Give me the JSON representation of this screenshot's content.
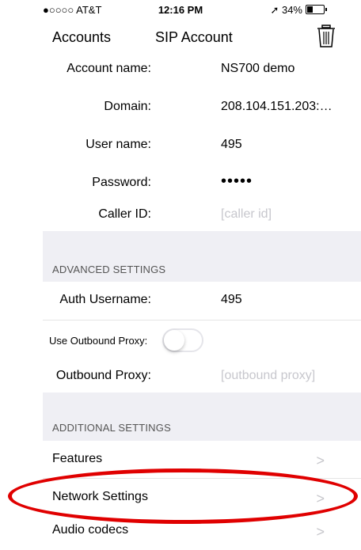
{
  "status_bar": {
    "carrier": "●○○○○ AT&T",
    "time": "12:16 PM",
    "battery": "34%",
    "icons": [
      "signal-dots-icon",
      "wifi-icon",
      "location-arrow-icon",
      "battery-icon"
    ]
  },
  "nav": {
    "back_label": "Accounts",
    "title": "SIP Account",
    "delete_icon": "trash-icon"
  },
  "account": {
    "rows": [
      {
        "label": "Account name:",
        "value": "NS700 demo",
        "placeholder": false
      },
      {
        "label": "Domain:",
        "value": "208.104.151.203:…",
        "placeholder": false
      },
      {
        "label": "User name:",
        "value": "495",
        "placeholder": false
      },
      {
        "label": "Password:",
        "value": "•••••",
        "placeholder": false
      },
      {
        "label": "Caller ID:",
        "value": "[caller id]",
        "placeholder": true
      }
    ]
  },
  "advanced": {
    "header": "ADVANCED SETTINGS",
    "auth_username_label": "Auth Username:",
    "auth_username_value": "495",
    "use_outbound_proxy_label": "Use Outbound Proxy:",
    "use_outbound_proxy_on": false,
    "outbound_proxy_label": "Outbound Proxy:",
    "outbound_proxy_placeholder": "[outbound proxy]"
  },
  "additional": {
    "header": "ADDITIONAL SETTINGS",
    "items": [
      {
        "label": "Features"
      },
      {
        "label": "Network Settings"
      },
      {
        "label": "Audio codecs"
      }
    ]
  },
  "colors": {
    "highlight": "#e00000",
    "group_background": "#efeff4",
    "placeholder": "#c7c7cd"
  }
}
